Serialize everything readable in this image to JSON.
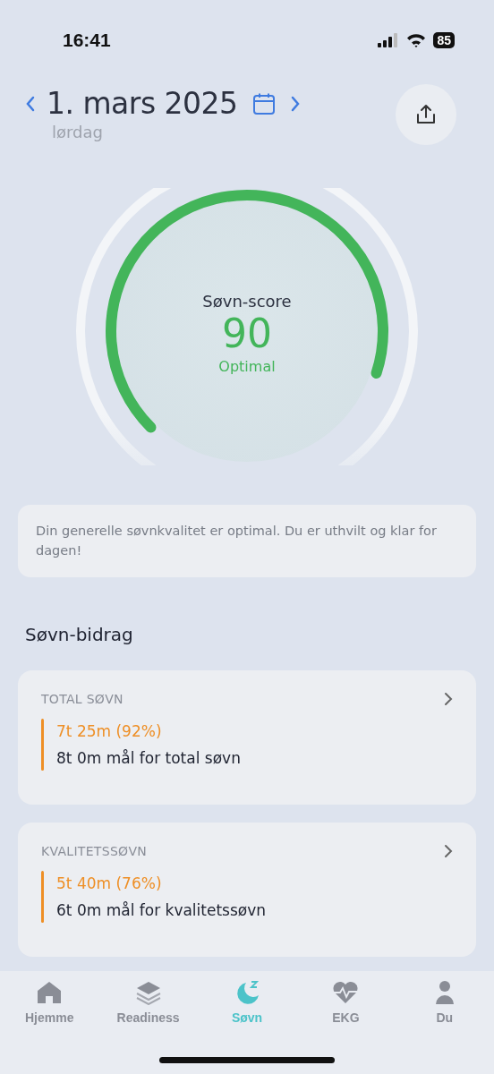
{
  "status_bar": {
    "time": "16:41",
    "battery": "85"
  },
  "header": {
    "date": "1. mars 2025",
    "weekday": "lørdag"
  },
  "score": {
    "label": "Søvn-score",
    "value": "90",
    "rating": "Optimal"
  },
  "summary": "Din generelle søvnkvalitet er optimal. Du er uthvilt og klar for dagen!",
  "section_title": "Søvn-bidrag",
  "contributors": [
    {
      "title": "TOTAL SØVN",
      "value": "7t 25m (92%)",
      "goal": "8t 0m mål for total søvn"
    },
    {
      "title": "KVALITETSSØVN",
      "value": "5t 40m (76%)",
      "goal": "6t 0m mål for kvalitetssøvn"
    }
  ],
  "tabs": [
    {
      "label": "Hjemme",
      "selected": false
    },
    {
      "label": "Readiness",
      "selected": false
    },
    {
      "label": "Søvn",
      "selected": true
    },
    {
      "label": "EKG",
      "selected": false
    },
    {
      "label": "Du",
      "selected": false
    }
  ]
}
